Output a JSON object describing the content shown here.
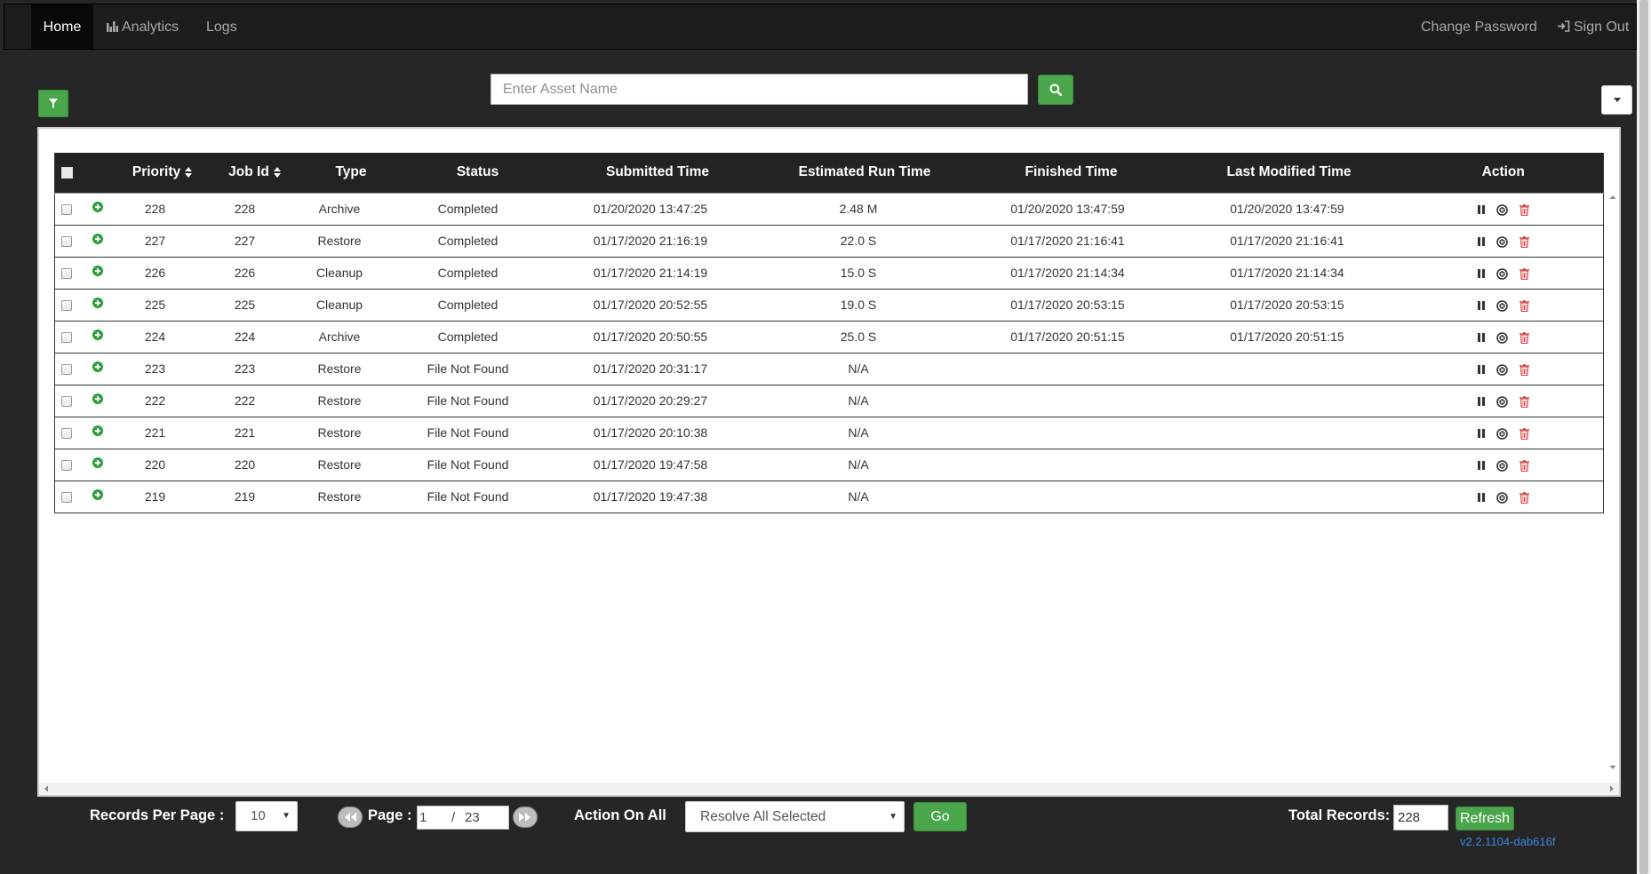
{
  "nav": {
    "home": "Home",
    "analytics": "Analytics",
    "logs": "Logs",
    "change_password": "Change Password",
    "sign_out": "Sign Out"
  },
  "search": {
    "placeholder": "Enter Asset Name"
  },
  "table": {
    "headers": {
      "priority": "Priority",
      "job_id": "Job Id",
      "type": "Type",
      "status": "Status",
      "submitted": "Submitted Time",
      "estimated": "Estimated Run Time",
      "finished": "Finished Time",
      "modified": "Last Modified Time",
      "action": "Action"
    },
    "rows": [
      {
        "priority": "228",
        "job_id": "228",
        "type": "Archive",
        "status": "Completed",
        "submitted": "01/20/2020 13:47:25",
        "estimated": "2.48 M",
        "finished": "01/20/2020 13:47:59",
        "modified": "01/20/2020 13:47:59"
      },
      {
        "priority": "227",
        "job_id": "227",
        "type": "Restore",
        "status": "Completed",
        "submitted": "01/17/2020 21:16:19",
        "estimated": "22.0 S",
        "finished": "01/17/2020 21:16:41",
        "modified": "01/17/2020 21:16:41"
      },
      {
        "priority": "226",
        "job_id": "226",
        "type": "Cleanup",
        "status": "Completed",
        "submitted": "01/17/2020 21:14:19",
        "estimated": "15.0 S",
        "finished": "01/17/2020 21:14:34",
        "modified": "01/17/2020 21:14:34"
      },
      {
        "priority": "225",
        "job_id": "225",
        "type": "Cleanup",
        "status": "Completed",
        "submitted": "01/17/2020 20:52:55",
        "estimated": "19.0 S",
        "finished": "01/17/2020 20:53:15",
        "modified": "01/17/2020 20:53:15"
      },
      {
        "priority": "224",
        "job_id": "224",
        "type": "Archive",
        "status": "Completed",
        "submitted": "01/17/2020 20:50:55",
        "estimated": "25.0 S",
        "finished": "01/17/2020 20:51:15",
        "modified": "01/17/2020 20:51:15"
      },
      {
        "priority": "223",
        "job_id": "223",
        "type": "Restore",
        "status": "File Not Found",
        "submitted": "01/17/2020 20:31:17",
        "estimated": "N/A",
        "finished": "",
        "modified": ""
      },
      {
        "priority": "222",
        "job_id": "222",
        "type": "Restore",
        "status": "File Not Found",
        "submitted": "01/17/2020 20:29:27",
        "estimated": "N/A",
        "finished": "",
        "modified": ""
      },
      {
        "priority": "221",
        "job_id": "221",
        "type": "Restore",
        "status": "File Not Found",
        "submitted": "01/17/2020 20:10:38",
        "estimated": "N/A",
        "finished": "",
        "modified": ""
      },
      {
        "priority": "220",
        "job_id": "220",
        "type": "Restore",
        "status": "File Not Found",
        "submitted": "01/17/2020 19:47:58",
        "estimated": "N/A",
        "finished": "",
        "modified": ""
      },
      {
        "priority": "219",
        "job_id": "219",
        "type": "Restore",
        "status": "File Not Found",
        "submitted": "01/17/2020 19:47:38",
        "estimated": "N/A",
        "finished": "",
        "modified": ""
      }
    ]
  },
  "footer": {
    "records_per_page_label": "Records Per Page :",
    "records_per_page_value": "10",
    "page_label": "Page :",
    "current_page": "1",
    "page_separator": "/",
    "total_pages": "23",
    "action_on_all_label": "Action On All",
    "action_selected": "Resolve All Selected",
    "go_label": "Go",
    "total_records_label": "Total Records:",
    "total_records_value": "228",
    "refresh_label": "Refresh",
    "version": "v2.2.1104-dab616f"
  },
  "colors": {
    "accent_green": "#4aa64a",
    "delete_red": "#d9534f",
    "background": "#262626",
    "header_dark": "#232323",
    "version_blue": "#3a86e0"
  },
  "icons": {
    "analytics": "bar-chart-icon",
    "sign_out": "sign-in-icon",
    "filter": "filter-icon",
    "search": "search-icon",
    "expand": "plus-circle-icon",
    "pause": "pause-icon",
    "cancel": "cancel-circle-icon",
    "delete": "trash-icon"
  }
}
